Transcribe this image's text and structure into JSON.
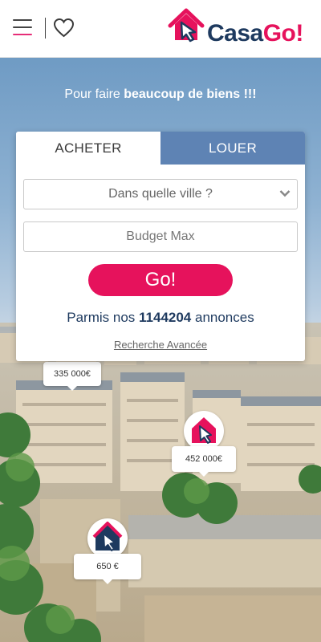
{
  "header": {
    "menu_icon": "hamburger-menu-icon",
    "favorites_icon": "heart-icon",
    "logo": {
      "part1": "Casa",
      "part2": "Go!"
    },
    "colors": {
      "brand_pink": "#e6125c",
      "brand_navy": "#1e3a5f"
    }
  },
  "hero": {
    "tagline_prefix": "Pour faire ",
    "tagline_bold": "beaucoup de biens !!!"
  },
  "search": {
    "tabs": [
      {
        "label": "ACHETER",
        "active": true
      },
      {
        "label": "LOUER",
        "active": false
      }
    ],
    "city_placeholder": "Dans quelle ville ?",
    "budget_placeholder": "Budget Max",
    "go_label": "Go!",
    "count_prefix": "Parmis nos ",
    "count_value": "1144204",
    "count_suffix": " annonces",
    "advanced_link": "Recherche Avancée",
    "tab_active_color": "#ffffff",
    "tab_inactive_color": "#5e83b4"
  },
  "markers": [
    {
      "price": "335 000€",
      "icon": "house-cursor-icon"
    },
    {
      "price": "452 000€",
      "icon": "house-cursor-icon"
    },
    {
      "price": "650 €",
      "icon": "house-cursor-icon"
    }
  ]
}
